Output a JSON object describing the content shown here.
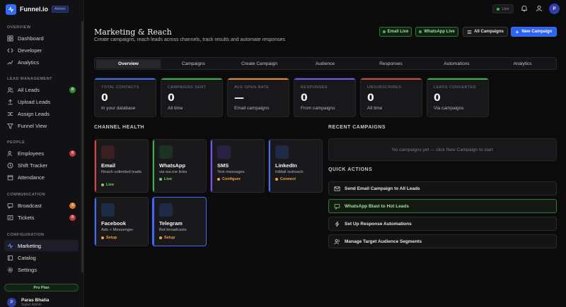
{
  "brand": {
    "name": "Funnel.io",
    "badge": "Admin"
  },
  "topbar": {
    "live_label": "Live",
    "avatar_initial": "P"
  },
  "sidebar": {
    "sections": {
      "overview": "OVERVIEW",
      "lead_management": "LEAD MANAGEMENT",
      "people": "PEOPLE",
      "communication": "COMMUNICATION",
      "configuration": "CONFIGURATION"
    },
    "items": {
      "dashboard": "Dashboard",
      "developer": "Developer",
      "analytics": "Analytics",
      "all_leads": "All Leads",
      "upload_leads": "Upload Leads",
      "assign_leads": "Assign Leads",
      "funnel_view": "Funnel View",
      "employees": "Employees",
      "shift_tracker": "Shift Tracker",
      "attendance": "Attendance",
      "broadcast": "Broadcast",
      "tickets": "Tickets",
      "marketing": "Marketing",
      "catalog": "Catalog",
      "settings": "Settings"
    },
    "counts": {
      "all_leads": "0",
      "employees": "0",
      "broadcast": "3",
      "tickets": "0"
    },
    "pro_plan": "Pro Plan",
    "user": {
      "initial": "P",
      "name": "Paras Bhatia",
      "role": "Super Admin"
    }
  },
  "header": {
    "title": "Marketing & Reach",
    "subtitle": "Create campaigns, reach leads across channels, track results and automate responses",
    "email_live": "Email Live",
    "whatsapp_live": "WhatsApp Live",
    "all_campaigns": "All Campaigns",
    "new_campaign": "New Campaign"
  },
  "tabs": [
    "Overview",
    "Campaigns",
    "Create Campaign",
    "Audience",
    "Responses",
    "Automations",
    "Analytics"
  ],
  "stats": [
    {
      "label": "TOTAL CONTACTS",
      "value": "0",
      "sub": "In your database",
      "color": "#3b6cff"
    },
    {
      "label": "CAMPAIGNS SENT",
      "value": "0",
      "sub": "All time",
      "color": "#38b24a"
    },
    {
      "label": "AVG OPEN RATE",
      "value": "—",
      "sub": "Email campaigns",
      "color": "#e88a2b"
    },
    {
      "label": "RESPONSES",
      "value": "0",
      "sub": "From campaigns",
      "color": "#7b4dff"
    },
    {
      "label": "UNSUBSCRIBES",
      "value": "0",
      "sub": "All time",
      "color": "#e04040"
    },
    {
      "label": "LEADS CONVERTED",
      "value": "0",
      "sub": "Via campaigns",
      "color": "#38b24a"
    }
  ],
  "channel_health": {
    "title": "CHANNEL HEALTH",
    "cards": [
      {
        "name": "Email",
        "desc": "Reach unlimited leads",
        "status": "Live",
        "edge": "#e04040",
        "icon_bg": "#3a1f22",
        "status_color": "#6fd46a"
      },
      {
        "name": "WhatsApp",
        "desc": "via wa.me links",
        "status": "Live",
        "edge": "#38b24a",
        "icon_bg": "#1d3322",
        "status_color": "#6fd46a"
      },
      {
        "name": "SMS",
        "desc": "Text messages",
        "status": "Configure",
        "edge": "#7b4dff",
        "icon_bg": "#2a2046",
        "status_color": "#f0a33a"
      },
      {
        "name": "LinkedIn",
        "desc": "InMail outreach",
        "status": "Connect",
        "edge": "#3b6cff",
        "icon_bg": "#1d2a48",
        "status_color": "#f0a33a"
      },
      {
        "name": "Facebook",
        "desc": "Ads + Messenger",
        "status": "Setup",
        "edge": "#3b6cff",
        "icon_bg": "#1d2a48",
        "status_color": "#f0a33a"
      },
      {
        "name": "Telegram",
        "desc": "Bot broadcasts",
        "status": "Setup",
        "edge": "#3b6cff",
        "icon_bg": "#1d2a48",
        "status_color": "#f0a33a"
      }
    ]
  },
  "recent_campaigns": {
    "title": "RECENT CAMPAIGNS",
    "empty": "No campaigns yet — click New Campaign to start"
  },
  "quick_actions": {
    "title": "QUICK ACTIONS",
    "items": [
      "Send Email Campaign to All Leads",
      "WhatsApp Blast to Hot Leads",
      "Set Up Response Automations",
      "Manage Target Audience Segments"
    ]
  }
}
